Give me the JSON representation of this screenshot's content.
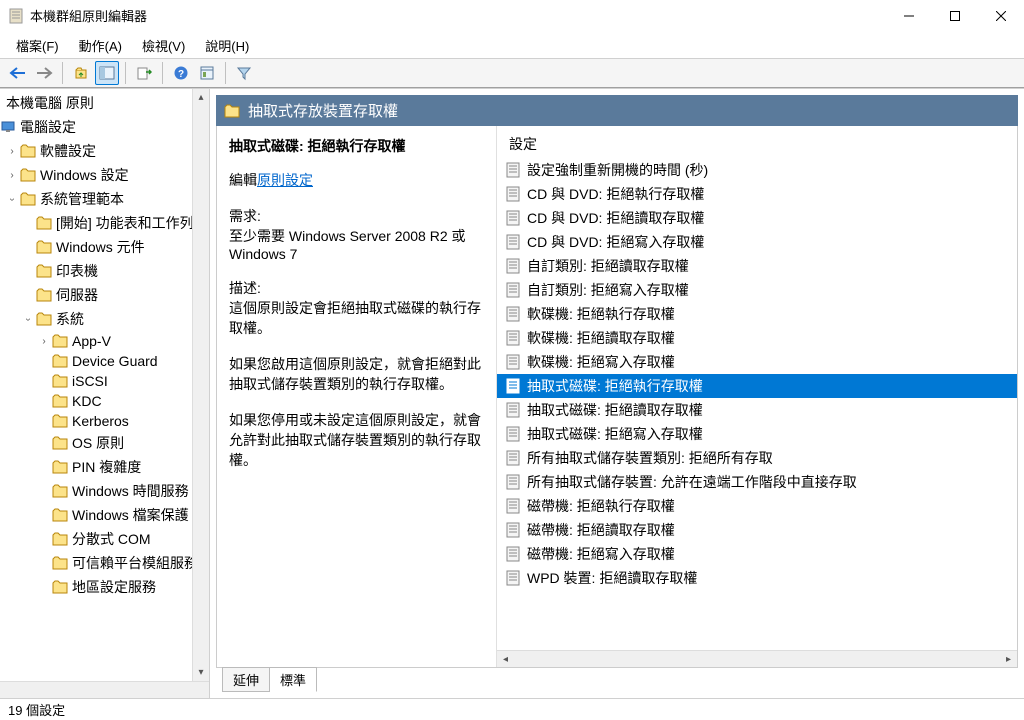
{
  "window": {
    "title": "本機群組原則編輯器"
  },
  "menu": {
    "file": "檔案(F)",
    "action": "動作(A)",
    "view": "檢視(V)",
    "help": "說明(H)"
  },
  "tree": {
    "root": "本機電腦 原則",
    "computer": "電腦設定",
    "soft": "軟體設定",
    "win": "Windows 設定",
    "admin": "系統管理範本",
    "start": "[開始] 功能表和工作列",
    "wincomp": "Windows 元件",
    "printer": "印表機",
    "server": "伺服器",
    "system": "系統",
    "appv": "App-V",
    "devguard": "Device Guard",
    "iscsi": "iSCSI",
    "kdc": "KDC",
    "kerberos": "Kerberos",
    "os": "OS 原則",
    "pin": "PIN 複雜度",
    "wtime": "Windows 時間服務",
    "wfile": "Windows 檔案保護",
    "dcom": "分散式 COM",
    "trusted": "可信賴平台模組服務",
    "locale": "地區設定服務"
  },
  "detail": {
    "heading": "抽取式存放裝置存取權",
    "setting_title": "抽取式磁碟: 拒絕執行存取權",
    "edit_label": "編輯",
    "edit_link": "原則設定",
    "req_label": "需求:",
    "req_text": "至少需要 Windows Server 2008 R2 或 Windows 7",
    "desc_label": "描述:",
    "desc_p1": "這個原則設定會拒絕抽取式磁碟的執行存取權。",
    "desc_p2": "如果您啟用這個原則設定，就會拒絕對此抽取式儲存裝置類別的執行存取權。",
    "desc_p3": "如果您停用或未設定這個原則設定，就會允許對此抽取式儲存裝置類別的執行存取權。",
    "col_header": "設定"
  },
  "settings": [
    "設定強制重新開機的時間 (秒)",
    "CD 與 DVD: 拒絕執行存取權",
    "CD 與 DVD: 拒絕讀取存取權",
    "CD 與 DVD: 拒絕寫入存取權",
    "自訂類別: 拒絕讀取存取權",
    "自訂類別: 拒絕寫入存取權",
    "軟碟機: 拒絕執行存取權",
    "軟碟機: 拒絕讀取存取權",
    "軟碟機: 拒絕寫入存取權",
    "抽取式磁碟: 拒絕執行存取權",
    "抽取式磁碟: 拒絕讀取存取權",
    "抽取式磁碟: 拒絕寫入存取權",
    "所有抽取式儲存裝置類別: 拒絕所有存取",
    "所有抽取式儲存裝置: 允許在遠端工作階段中直接存取",
    "磁帶機: 拒絕執行存取權",
    "磁帶機: 拒絕讀取存取權",
    "磁帶機: 拒絕寫入存取權",
    "WPD 裝置: 拒絕讀取存取權"
  ],
  "selected_index": 9,
  "tabs": {
    "extended": "延伸",
    "standard": "標準"
  },
  "status": "19 個設定"
}
